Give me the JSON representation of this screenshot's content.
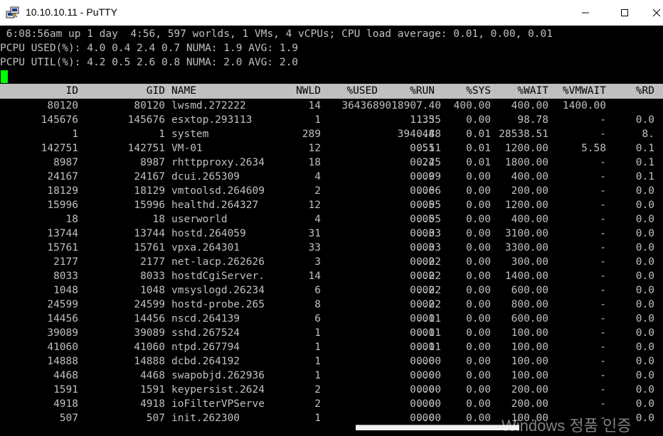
{
  "window": {
    "title": "10.10.10.11 - PuTTY",
    "app_icon": "putty-icon",
    "controls": {
      "minimize": "─",
      "maximize": "☐",
      "close": "✕"
    }
  },
  "terminal": {
    "status_lines": [
      " 6:08:56am up 1 day  4:56, 597 worlds, 1 VMs, 4 vCPUs; CPU load average: 0.01, 0.00, 0.01",
      "PCPU USED(%): 4.0 0.4 2.4 0.7 NUMA: 1.9 AVG: 1.9",
      "PCPU UTIL(%): 4.2 0.5 2.6 0.8 NUMA: 2.0 AVG: 2.0"
    ],
    "columns": [
      "ID",
      "GID",
      "NAME",
      "NWLD",
      "%USED",
      "%RUN",
      "%SYS",
      "%WAIT",
      "%VMWAIT",
      "%RD"
    ],
    "rows": [
      [
        "80120",
        "80120",
        "lwsmd.272222",
        "14",
        "3643689018907.40",
        "",
        "400.00",
        "400.00",
        "1400.00",
        ""
      ],
      [
        "145676",
        "145676",
        "esxtop.293113",
        "1",
        "1.35",
        "1.35",
        "0.00",
        "98.78",
        "-",
        "0.0"
      ],
      [
        "1",
        "1",
        "system",
        "289",
        "0.88",
        "394.44",
        "0.01",
        "28538.51",
        "-",
        "8."
      ],
      [
        "142751",
        "142751",
        "VM-01",
        "12",
        "0.51",
        "0.51",
        "0.01",
        "1200.00",
        "5.58",
        "0.1"
      ],
      [
        "8987",
        "8987",
        "rhttpproxy.2634",
        "18",
        "0.25",
        "0.24",
        "0.01",
        "1800.00",
        "-",
        "0.1"
      ],
      [
        "24167",
        "24167",
        "dcui.265309",
        "4",
        "0.09",
        "0.09",
        "0.00",
        "400.00",
        "-",
        "0.1"
      ],
      [
        "18129",
        "18129",
        "vmtoolsd.264609",
        "2",
        "0.06",
        "0.06",
        "0.00",
        "200.00",
        "-",
        "0.0"
      ],
      [
        "15996",
        "15996",
        "healthd.264327",
        "12",
        "0.05",
        "0.05",
        "0.00",
        "1200.00",
        "-",
        "0.0"
      ],
      [
        "18",
        "18",
        "userworld",
        "4",
        "0.05",
        "0.05",
        "0.00",
        "400.00",
        "-",
        "0.0"
      ],
      [
        "13744",
        "13744",
        "hostd.264059",
        "31",
        "0.03",
        "0.03",
        "0.00",
        "3100.00",
        "-",
        "0.0"
      ],
      [
        "15761",
        "15761",
        "vpxa.264301",
        "33",
        "0.03",
        "0.03",
        "0.00",
        "3300.00",
        "-",
        "0.0"
      ],
      [
        "2177",
        "2177",
        "net-lacp.262626",
        "3",
        "0.02",
        "0.02",
        "0.00",
        "300.00",
        "-",
        "0.0"
      ],
      [
        "8033",
        "8033",
        "hostdCgiServer.",
        "14",
        "0.02",
        "0.02",
        "0.00",
        "1400.00",
        "-",
        "0.0"
      ],
      [
        "1048",
        "1048",
        "vmsyslogd.26234",
        "6",
        "0.02",
        "0.02",
        "0.00",
        "600.00",
        "-",
        "0.0"
      ],
      [
        "24599",
        "24599",
        "hostd-probe.265",
        "8",
        "0.02",
        "0.02",
        "0.00",
        "800.00",
        "-",
        "0.0"
      ],
      [
        "14456",
        "14456",
        "nscd.264139",
        "6",
        "0.01",
        "0.01",
        "0.00",
        "600.00",
        "-",
        "0.0"
      ],
      [
        "39089",
        "39089",
        "sshd.267524",
        "1",
        "0.01",
        "0.01",
        "0.00",
        "100.00",
        "-",
        "0.0"
      ],
      [
        "41060",
        "41060",
        "ntpd.267794",
        "1",
        "0.01",
        "0.01",
        "0.00",
        "100.00",
        "-",
        "0.0"
      ],
      [
        "14888",
        "14888",
        "dcbd.264192",
        "1",
        "0.00",
        "0.00",
        "0.00",
        "100.00",
        "-",
        "0.0"
      ],
      [
        "4468",
        "4468",
        "swapobjd.262936",
        "1",
        "0.00",
        "0.00",
        "0.00",
        "100.00",
        "-",
        "0.0"
      ],
      [
        "1591",
        "1591",
        "keypersist.2624",
        "2",
        "0.00",
        "0.00",
        "0.00",
        "200.00",
        "-",
        "0.0"
      ],
      [
        "4918",
        "4918",
        "ioFilterVPServe",
        "2",
        "0.00",
        "0.00",
        "0.00",
        "200.00",
        "-",
        "0.0"
      ],
      [
        "507",
        "507",
        "init.262300",
        "1",
        "0.00",
        "0.00",
        "0.00",
        "100.00",
        "-",
        "0.0"
      ]
    ]
  },
  "overlay": {
    "watermark": "Windows 정품 인증"
  },
  "colors": {
    "background": "#000000",
    "text": "#c0c0c0",
    "header_bg": "#c0c0c0",
    "cursor": "#00ff00"
  }
}
